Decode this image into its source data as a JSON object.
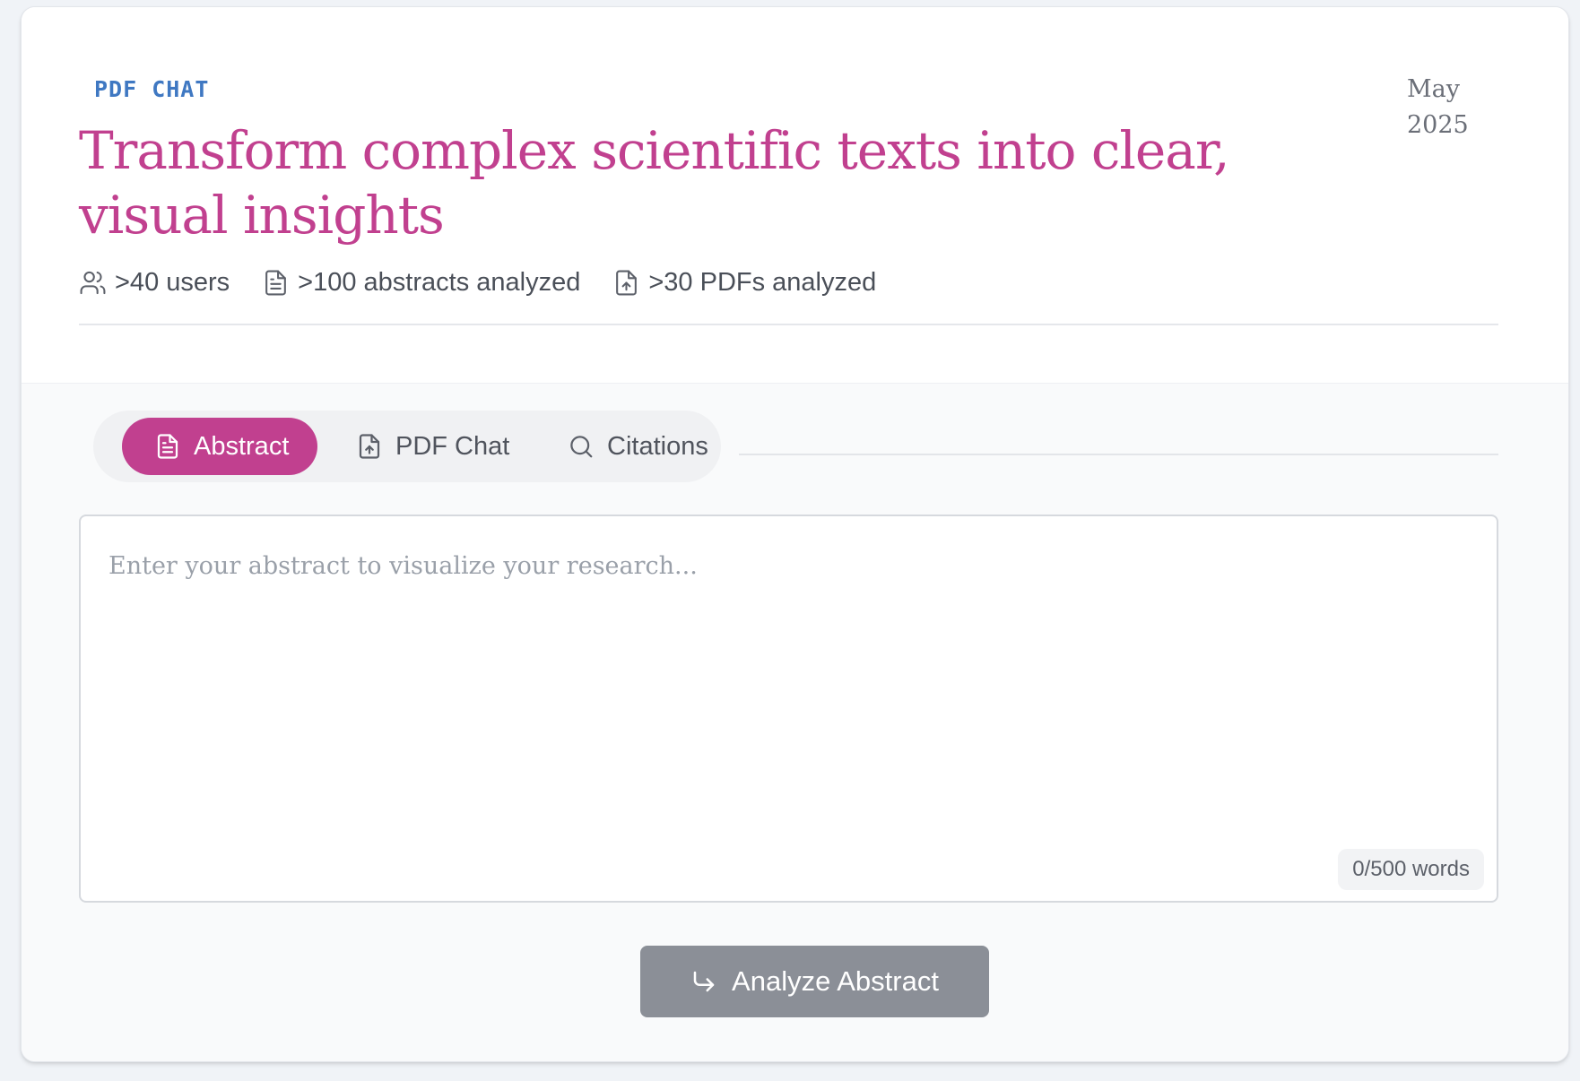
{
  "header": {
    "eyebrow": "PDF CHAT",
    "title": "Transform complex scientific texts into clear, visual insights",
    "date": "May 2025",
    "stats": [
      {
        "icon": "users-icon",
        "label": ">40 users"
      },
      {
        "icon": "file-text-icon",
        "label": ">100 abstracts analyzed"
      },
      {
        "icon": "file-upload-icon",
        "label": ">30 PDFs analyzed"
      }
    ]
  },
  "tabs": [
    {
      "icon": "file-text-icon",
      "label": "Abstract",
      "active": true
    },
    {
      "icon": "file-upload-icon",
      "label": "PDF Chat",
      "active": false
    },
    {
      "icon": "search-icon",
      "label": "Citations",
      "active": false
    }
  ],
  "abstract_input": {
    "value": "",
    "placeholder": "Enter your abstract to visualize your research...",
    "word_count": "0/500 words"
  },
  "analyze_button": {
    "icon": "corner-down-right-icon",
    "label": "Analyze Abstract"
  },
  "colors": {
    "accent": "#c1408f",
    "eyebrow": "#3f78c2",
    "button_disabled": "#8b8f97"
  }
}
